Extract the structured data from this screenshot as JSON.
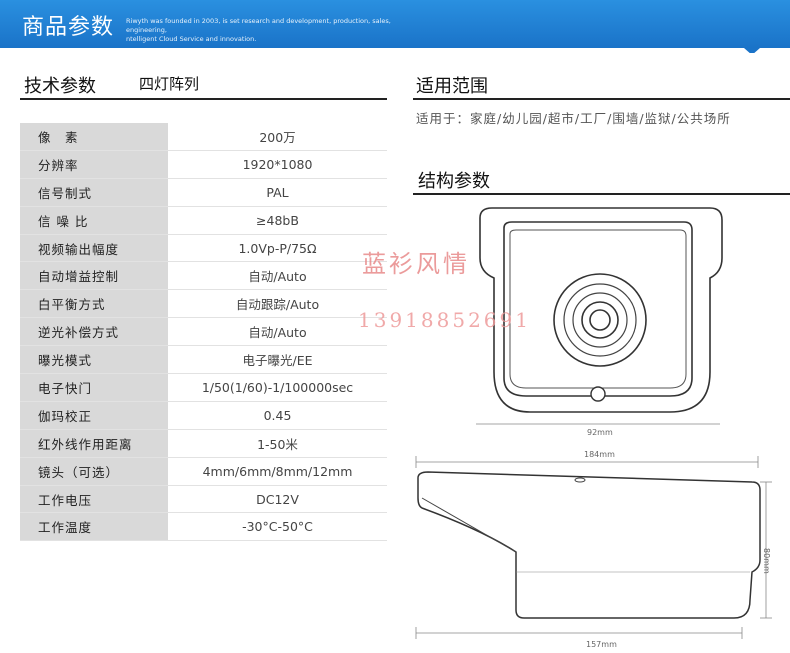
{
  "banner": {
    "title": "商品参数",
    "subtitle_line1": "Riwyth was founded in 2003, is set research and development, production, sales, engineering,",
    "subtitle_line2": "ntelligent Cloud Service and innovation."
  },
  "tech": {
    "title": "技术参数",
    "subtitle": "四灯阵列"
  },
  "specs": [
    {
      "label": "像　素",
      "value": "200万"
    },
    {
      "label": "分辨率",
      "value": "1920*1080"
    },
    {
      "label": "信号制式",
      "value": "PAL"
    },
    {
      "label": "信 噪 比",
      "value": "≥48bB"
    },
    {
      "label": "视频输出幅度",
      "value": "1.0Vp-P/75Ω"
    },
    {
      "label": "自动增益控制",
      "value": "自动/Auto"
    },
    {
      "label": "白平衡方式",
      "value": "自动跟踪/Auto"
    },
    {
      "label": "逆光补偿方式",
      "value": "自动/Auto"
    },
    {
      "label": "曝光模式",
      "value": "电子曝光/EE"
    },
    {
      "label": "电子快门",
      "value": "1/50(1/60)-1/100000sec"
    },
    {
      "label": "伽玛校正",
      "value": "0.45"
    },
    {
      "label": "红外线作用距离",
      "value": "1-50米"
    },
    {
      "label": "镜头（可选）",
      "value": "4mm/6mm/8mm/12mm"
    },
    {
      "label": "工作电压",
      "value": "DC12V"
    },
    {
      "label": "工作温度",
      "value": "-30°C-50°C"
    }
  ],
  "scope": {
    "title": "适用范围",
    "text": "适用于：家庭/幼儿园/超市/工厂/围墙/监狱/公共场所"
  },
  "structure": {
    "title": "结构参数",
    "dim_front_width": "92mm",
    "dim_top_length": "184mm",
    "dim_height": "80mm",
    "dim_bottom_length": "157mm"
  },
  "watermark": {
    "name": "蓝衫风情",
    "phone": "13918852691"
  },
  "colors": {
    "banner": "#1a73c8",
    "label_bg": "#d9d9d9",
    "watermark": "#e88a8a"
  }
}
